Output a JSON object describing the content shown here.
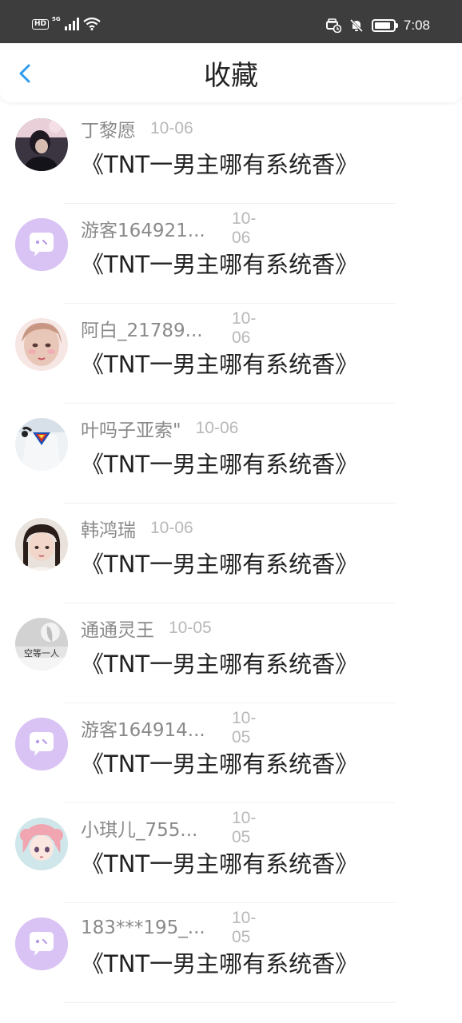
{
  "status_bar": {
    "left_badge": "HD",
    "network_label": "5G",
    "time": "7:08",
    "battery_level": 0.85,
    "icons": [
      "hd-icon",
      "signal-icon",
      "wifi-icon",
      "car-mode-icon",
      "mute-bell-icon",
      "battery-icon"
    ]
  },
  "header": {
    "title": "收藏",
    "back_icon": "chevron-left-icon",
    "accent_color": "#2f9bf0"
  },
  "items": [
    {
      "nickname": "丁黎愿",
      "date": "10-06",
      "title": "《TNT一男主哪有系统香》",
      "avatar": "photo-dark-hair"
    },
    {
      "nickname": "游客164921...",
      "date": "10-06",
      "title": "《TNT一男主哪有系统香》",
      "avatar": "guest-chat-bubble"
    },
    {
      "nickname": "阿白_21789...",
      "date": "10-06",
      "title": "《TNT一男主哪有系统香》",
      "avatar": "photo-pink-portrait"
    },
    {
      "nickname": "叶吗子亚索\"",
      "date": "10-06",
      "title": "《TNT一男主哪有系统香》",
      "avatar": "photo-superman-shirt"
    },
    {
      "nickname": "韩鸿瑞",
      "date": "10-06",
      "title": "《TNT一男主哪有系统香》",
      "avatar": "photo-girl-bangs"
    },
    {
      "nickname": "通通灵王",
      "date": "10-05",
      "title": "《TNT一男主哪有系统香》",
      "avatar": "photo-grey-text",
      "avatar_text": "空等一人"
    },
    {
      "nickname": "游客164914...",
      "date": "10-05",
      "title": "《TNT一男主哪有系统香》",
      "avatar": "guest-chat-bubble"
    },
    {
      "nickname": "小琪儿_755...",
      "date": "10-05",
      "title": "《TNT一男主哪有系统香》",
      "avatar": "anime-pink-hair"
    },
    {
      "nickname": "183***195_...",
      "date": "10-05",
      "title": "《TNT一男主哪有系统香》",
      "avatar": "guest-chat-bubble"
    }
  ],
  "colors": {
    "guest_avatar_bg": "#d9c3f5",
    "nickname": "#8a8a8a",
    "date": "#b8b8b8",
    "title_text": "#222222",
    "status_bar_bg": "#3d3d3d"
  }
}
